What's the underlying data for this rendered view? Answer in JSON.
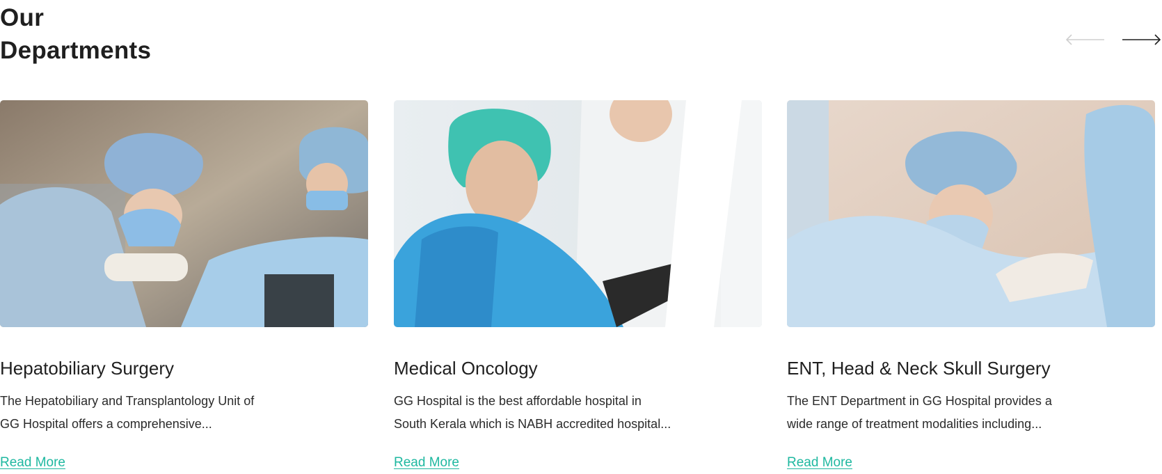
{
  "section": {
    "title_line1": "Our",
    "title_line2": "Departments"
  },
  "nav": {
    "prev_icon": "arrow-left-icon",
    "next_icon": "arrow-right-icon",
    "prev_color": "#cfcfcf",
    "next_color": "#1f1f1f"
  },
  "departments": [
    {
      "title": "Hepatobiliary Surgery",
      "line1": "The Hepatobiliary and Transplantology Unit of",
      "line2": "GG Hospital offers a comprehensive...",
      "link": "Read More"
    },
    {
      "title": "Medical Oncology",
      "line1": "GG Hospital is the best affordable hospital in",
      "line2": "South Kerala which is NABH accredited hospital...",
      "link": "Read More"
    },
    {
      "title": "ENT, Head & Neck Skull Surgery",
      "line1": "The ENT Department in GG Hospital provides a",
      "line2": "wide range of treatment modalities including...",
      "link": "Read More"
    }
  ],
  "colors": {
    "accent": "#1fb8a0",
    "text": "#1f1f1f"
  }
}
